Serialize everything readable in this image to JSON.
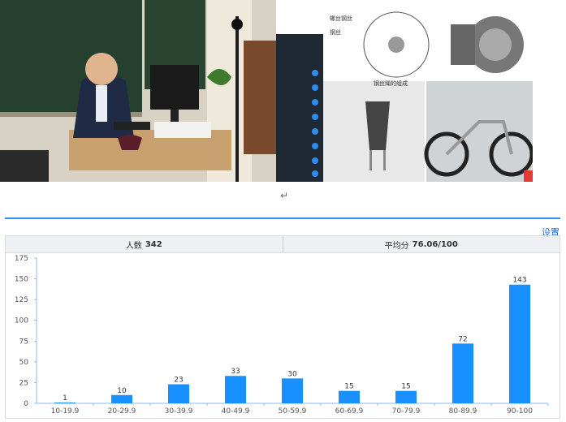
{
  "photos": {
    "left": {
      "subject": "teacher-at-desk-with-headset-photo"
    },
    "right": {
      "slide_labels": [
        "螺丝钢丝",
        "钢丝",
        "钢丝绳的组成"
      ]
    }
  },
  "return_mark": "↵",
  "settings_link": "设置",
  "stats": {
    "count_label": "人数",
    "count_value": "342",
    "avg_label": "平均分",
    "avg_value": "76.06/100"
  },
  "chart_data": {
    "type": "bar",
    "categories": [
      "10-19.9",
      "20-29.9",
      "30-39.9",
      "40-49.9",
      "50-59.9",
      "60-69.9",
      "70-79.9",
      "80-89.9",
      "90-100"
    ],
    "values": [
      1,
      10,
      23,
      33,
      30,
      15,
      15,
      72,
      143
    ],
    "yticks": [
      0,
      25,
      50,
      75,
      100,
      125,
      150,
      175
    ],
    "ylim": [
      0,
      175
    ],
    "title": "",
    "xlabel": "",
    "ylabel": "",
    "bar_color": "#1890ff",
    "grid": false
  }
}
